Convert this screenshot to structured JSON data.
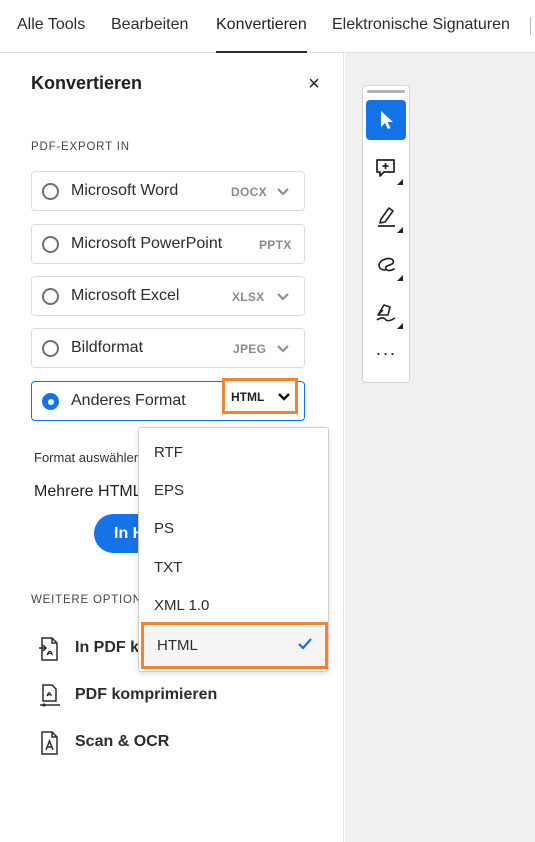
{
  "tabs": [
    "Alle Tools",
    "Bearbeiten",
    "Konvertieren",
    "Elektronische Signaturen"
  ],
  "panel": {
    "title": "Konvertieren",
    "close_glyph": "×",
    "export_label": "PDF-EXPORT IN",
    "options": [
      {
        "label": "Microsoft Word",
        "format": "DOCX",
        "has_chevron": true,
        "selected": false
      },
      {
        "label": "Microsoft PowerPoint",
        "format": "PPTX",
        "has_chevron": false,
        "selected": false
      },
      {
        "label": "Microsoft Excel",
        "format": "XLSX",
        "has_chevron": true,
        "selected": false
      },
      {
        "label": "Bildformat",
        "format": "JPEG",
        "has_chevron": true,
        "selected": false
      },
      {
        "label": "Anderes Format",
        "format": "HTML",
        "has_chevron": true,
        "selected": true
      }
    ],
    "format_select_text": "Format auswählen",
    "multiple_html_text": "Mehrere HTML-",
    "convert_button": "In H",
    "more_options_label": "WEITERE OPTIONEN",
    "more_items": [
      {
        "label": "In PDF konvertieren",
        "icon": "convert-to-pdf-icon"
      },
      {
        "label": "PDF komprimieren",
        "icon": "compress-pdf-icon"
      },
      {
        "label": "Scan & OCR",
        "icon": "scan-ocr-icon"
      }
    ]
  },
  "dropdown": {
    "items": [
      "RTF",
      "EPS",
      "PS",
      "TXT",
      "XML 1.0",
      "HTML"
    ],
    "selected": "HTML",
    "check_glyph": "✓"
  },
  "toolbar": {
    "tools": [
      "select-cursor-icon",
      "add-comment-icon",
      "highlight-icon",
      "draw-freehand-icon",
      "sign-icon"
    ],
    "active_tool": "select-cursor-icon",
    "more_glyph": "···"
  },
  "colors": {
    "accent": "#1473e6",
    "highlight_outline": "#f08433"
  }
}
